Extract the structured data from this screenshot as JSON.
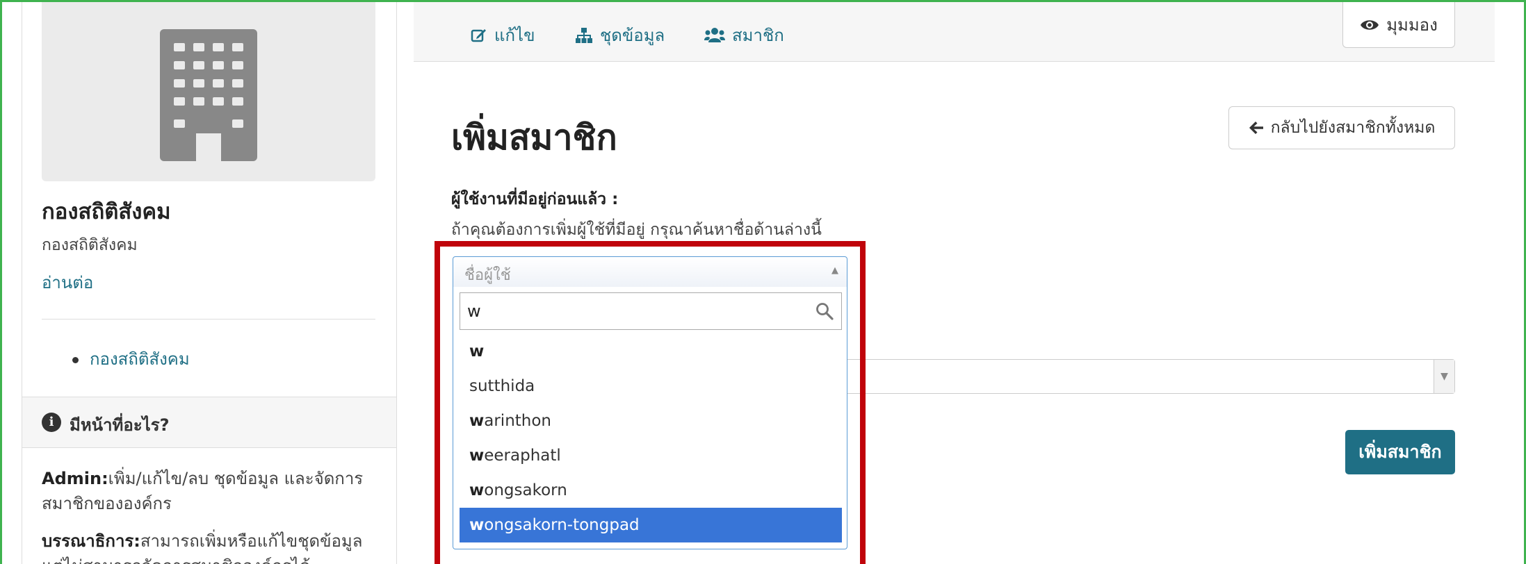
{
  "colors": {
    "accent": "#1f6f85",
    "highlight": "#3875d7",
    "annotation": "#c0040b",
    "frame": "#3fb34f"
  },
  "sidebar": {
    "org_title": "กองสถิติสังคม",
    "org_subtitle": "กองสถิติสังคม",
    "read_more": "อ่านต่อ",
    "org_list": [
      "กองสถิติสังคม"
    ],
    "info_title": "มีหน้าที่อะไร?",
    "info_items": [
      {
        "role": "Admin:",
        "text": "เพิ่ม/แก้ไข/ลบ ชุดข้อมูล และจัดการสมาชิกขององค์กร"
      },
      {
        "role": "บรรณาธิการ:",
        "text": "สามารถเพิ่มหรือแก้ไขชุดข้อมูลแต่ไม่สามารถจัดการสมาชิกองค์กรได้"
      }
    ]
  },
  "topnav": {
    "items": [
      {
        "label": "แก้ไข",
        "icon": "edit-icon"
      },
      {
        "label": "ชุดข้อมูล",
        "icon": "sitemap-icon"
      },
      {
        "label": "สมาชิก",
        "icon": "users-icon"
      }
    ],
    "view_label": "มุมมอง"
  },
  "main": {
    "title": "เพิ่มสมาชิก",
    "back_label": "กลับไปยังสมาชิกทั้งหมด",
    "existing_label": "ผู้ใช้งานที่มีอยู่ก่อนแล้ว :",
    "existing_help": "ถ้าคุณต้องการเพิ่มผู้ใช้ที่มีอยู่ กรุณาค้นหาชื่อด้านล่างนี้",
    "add_button": "เพิ่มสมาชิก"
  },
  "user_select": {
    "placeholder": "ชื่อผู้ใช้",
    "search_value": "w",
    "options": [
      {
        "match": "w",
        "rest": ""
      },
      {
        "match": "",
        "rest": "sutthida"
      },
      {
        "match": "w",
        "rest": "arinthon"
      },
      {
        "match": "w",
        "rest": "eeraphatl"
      },
      {
        "match": "w",
        "rest": "ongsakorn"
      },
      {
        "match": "w",
        "rest": "ongsakorn-tongpad"
      }
    ],
    "highlighted_index": 5
  }
}
